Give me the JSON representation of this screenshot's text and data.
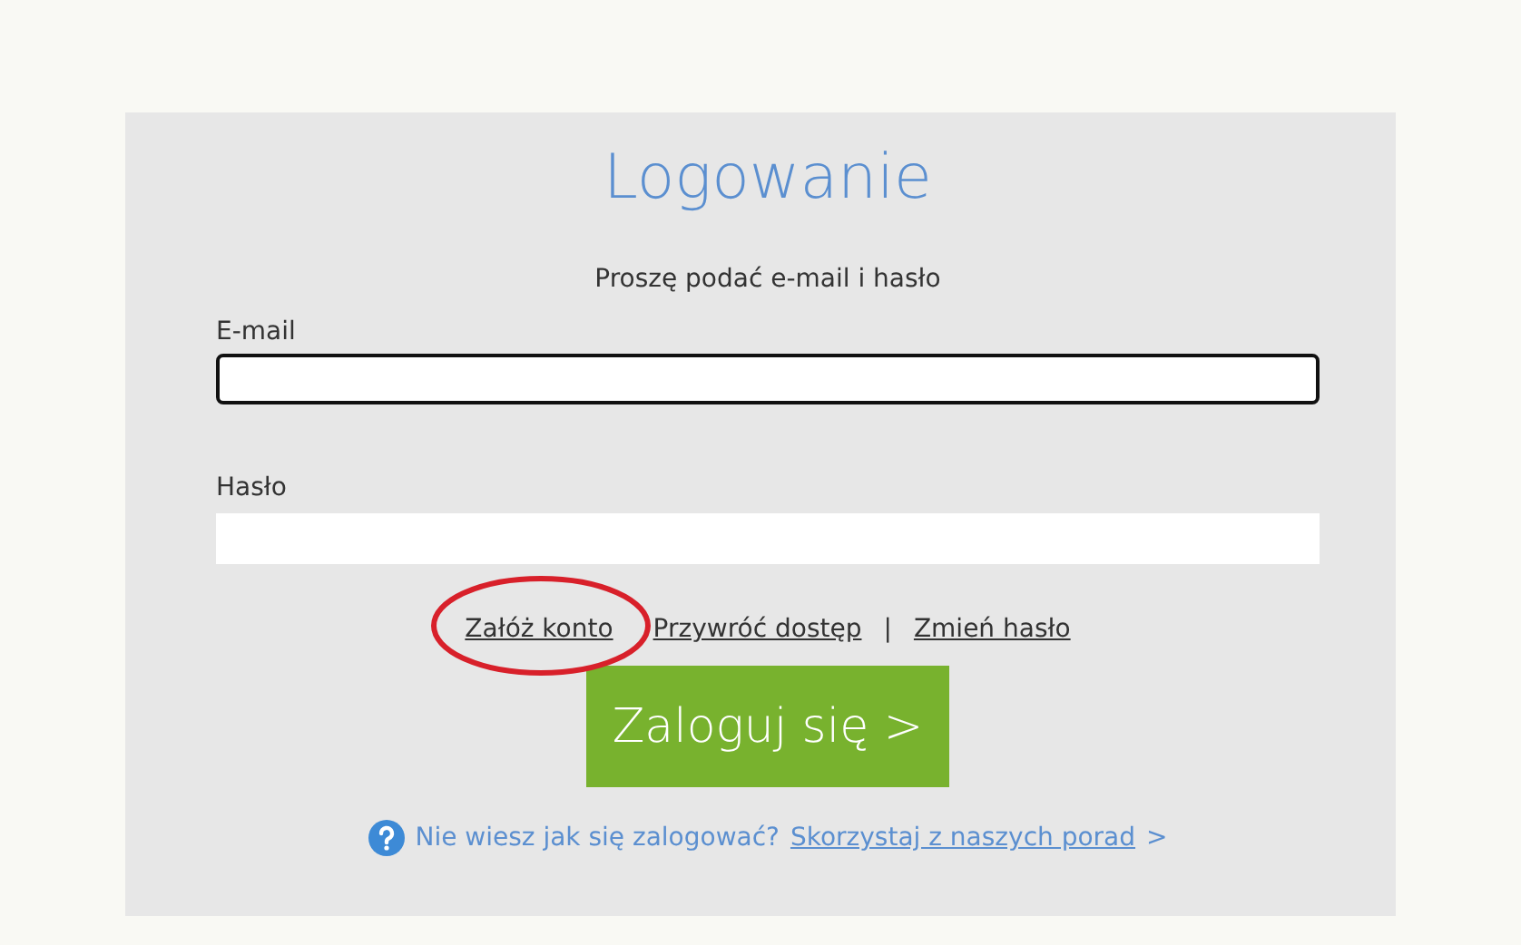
{
  "title": "Logowanie",
  "subtitle": "Proszę podać e-mail i hasło",
  "fields": [
    {
      "label": "E-mail",
      "focused": true
    },
    {
      "label": "Hasło",
      "focused": false
    }
  ],
  "links": [
    {
      "kind": "link",
      "label": "Załóż konto",
      "circled": true
    },
    {
      "kind": "link",
      "label": "Przywróć dostęp",
      "circled": false
    },
    {
      "kind": "separator",
      "label": "|"
    },
    {
      "kind": "link",
      "label": "Zmień hasło",
      "circled": false
    }
  ],
  "submit": {
    "label": "Zaloguj się >"
  },
  "help": {
    "question": "Nie wiesz jak się zalogować?",
    "link": "Skorzystaj z naszych porad",
    "arrow": ">"
  }
}
